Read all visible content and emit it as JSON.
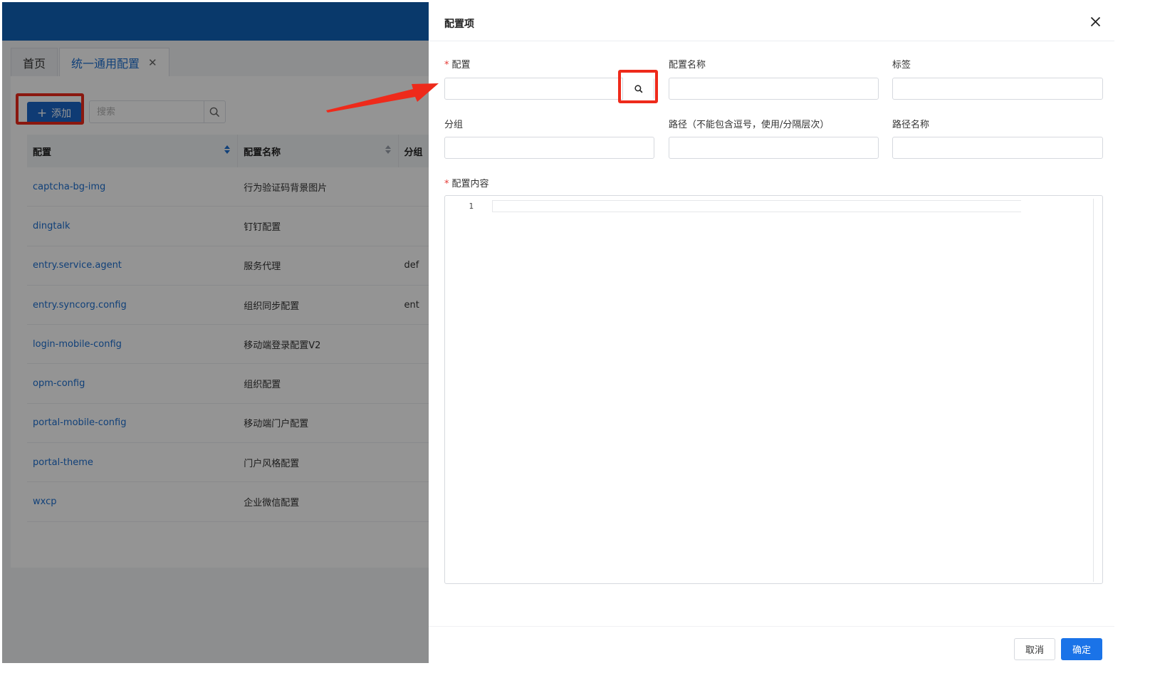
{
  "colors": {
    "topbar": "#1163b8",
    "link": "#1d6fd0",
    "primary": "#1a73e8",
    "highlight": "#ee2a1b"
  },
  "tabs": [
    {
      "label": "首页"
    },
    {
      "label": "统一通用配置",
      "close_icon": "close-icon"
    }
  ],
  "toolbar": {
    "add_label": "添加",
    "search_placeholder": "搜索"
  },
  "table": {
    "columns": [
      "配置",
      "配置名称",
      "分组"
    ],
    "rows": [
      {
        "config": "captcha-bg-img",
        "name": "行为验证码背景图片",
        "group": ""
      },
      {
        "config": "dingtalk",
        "name": "钉钉配置",
        "group": ""
      },
      {
        "config": "entry.service.agent",
        "name": "服务代理",
        "group": "def"
      },
      {
        "config": "entry.syncorg.config",
        "name": "组织同步配置",
        "group": "ent"
      },
      {
        "config": "login-mobile-config",
        "name": "移动端登录配置V2",
        "group": ""
      },
      {
        "config": "opm-config",
        "name": "组织配置",
        "group": ""
      },
      {
        "config": "portal-mobile-config",
        "name": "移动端门户配置",
        "group": ""
      },
      {
        "config": "portal-theme",
        "name": "门户风格配置",
        "group": ""
      },
      {
        "config": "wxcp",
        "name": "企业微信配置",
        "group": ""
      }
    ]
  },
  "drawer": {
    "title": "配置项",
    "required_mark": "*",
    "fields": {
      "config": {
        "label": "配置",
        "value": ""
      },
      "config_name": {
        "label": "配置名称",
        "value": ""
      },
      "tag": {
        "label": "标签",
        "value": ""
      },
      "group": {
        "label": "分组",
        "value": ""
      },
      "path": {
        "label": "路径（不能包含逗号，使用/分隔层次）",
        "value": ""
      },
      "path_name": {
        "label": "路径名称",
        "value": ""
      }
    },
    "content": {
      "label": "配置内容",
      "line_number": "1"
    },
    "footer": {
      "cancel_label": "取消",
      "ok_label": "确定"
    }
  }
}
